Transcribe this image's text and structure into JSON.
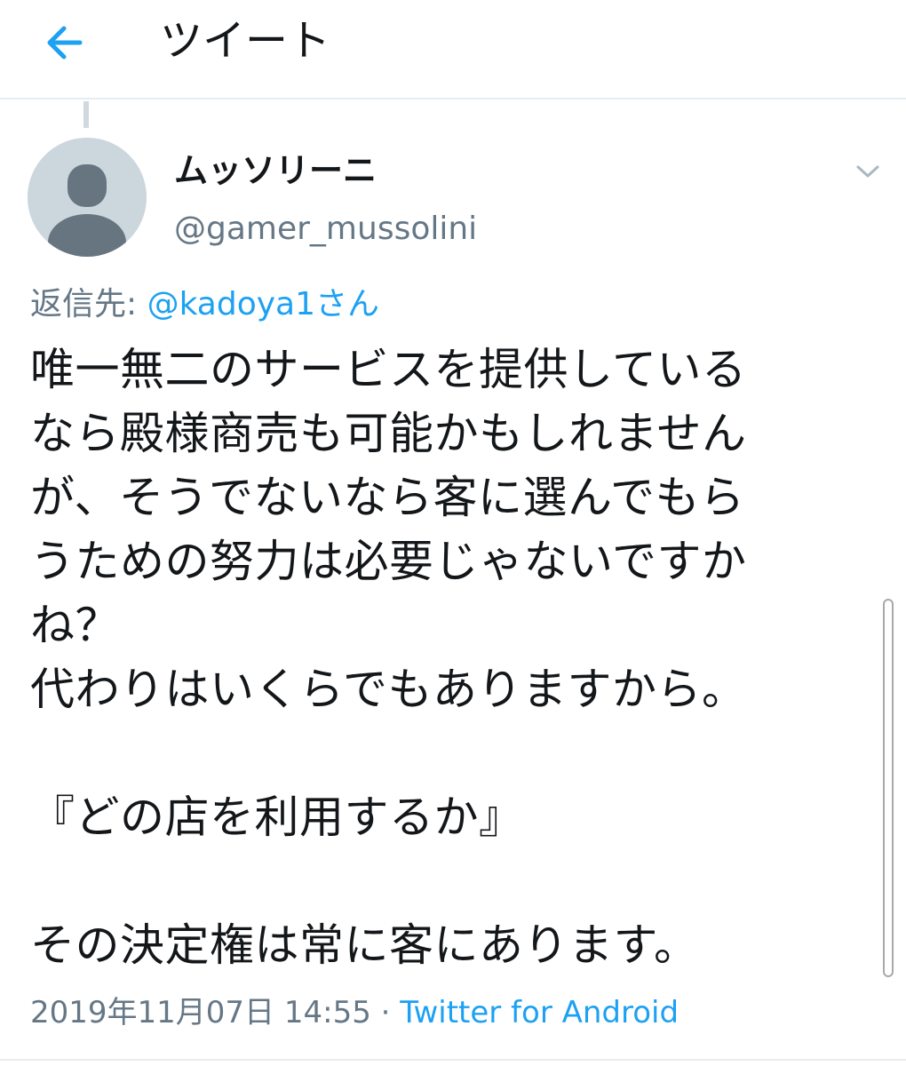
{
  "header": {
    "title": "ツイート",
    "back_icon": "arrow-left-icon",
    "accent_color": "#1da1f2"
  },
  "tweet": {
    "display_name": "ムッソリーニ",
    "handle": "@gamer_mussolini",
    "avatar_icon": "default-profile-avatar",
    "menu_icon": "chevron-down-icon",
    "reply_prefix": "返信先: ",
    "reply_to": "@kadoya1さん",
    "text_lines": [
      "唯一無二のサービスを提供している",
      "なら殿様商売も可能かもしれません",
      "が、そうでないなら客に選んでもら",
      "うための努力は必要じゃないですか",
      "ね？",
      "代わりはいくらでもありますから。",
      "",
      "『どの店を利用するか』",
      "",
      "その決定権は常に客にあります。"
    ],
    "timestamp": "2019年11月07日 14:55",
    "separator": " · ",
    "source": "Twitter for Android"
  },
  "colors": {
    "text": "#14171a",
    "muted": "#657786",
    "link": "#1da1f2",
    "divider": "#e6ecf0"
  }
}
